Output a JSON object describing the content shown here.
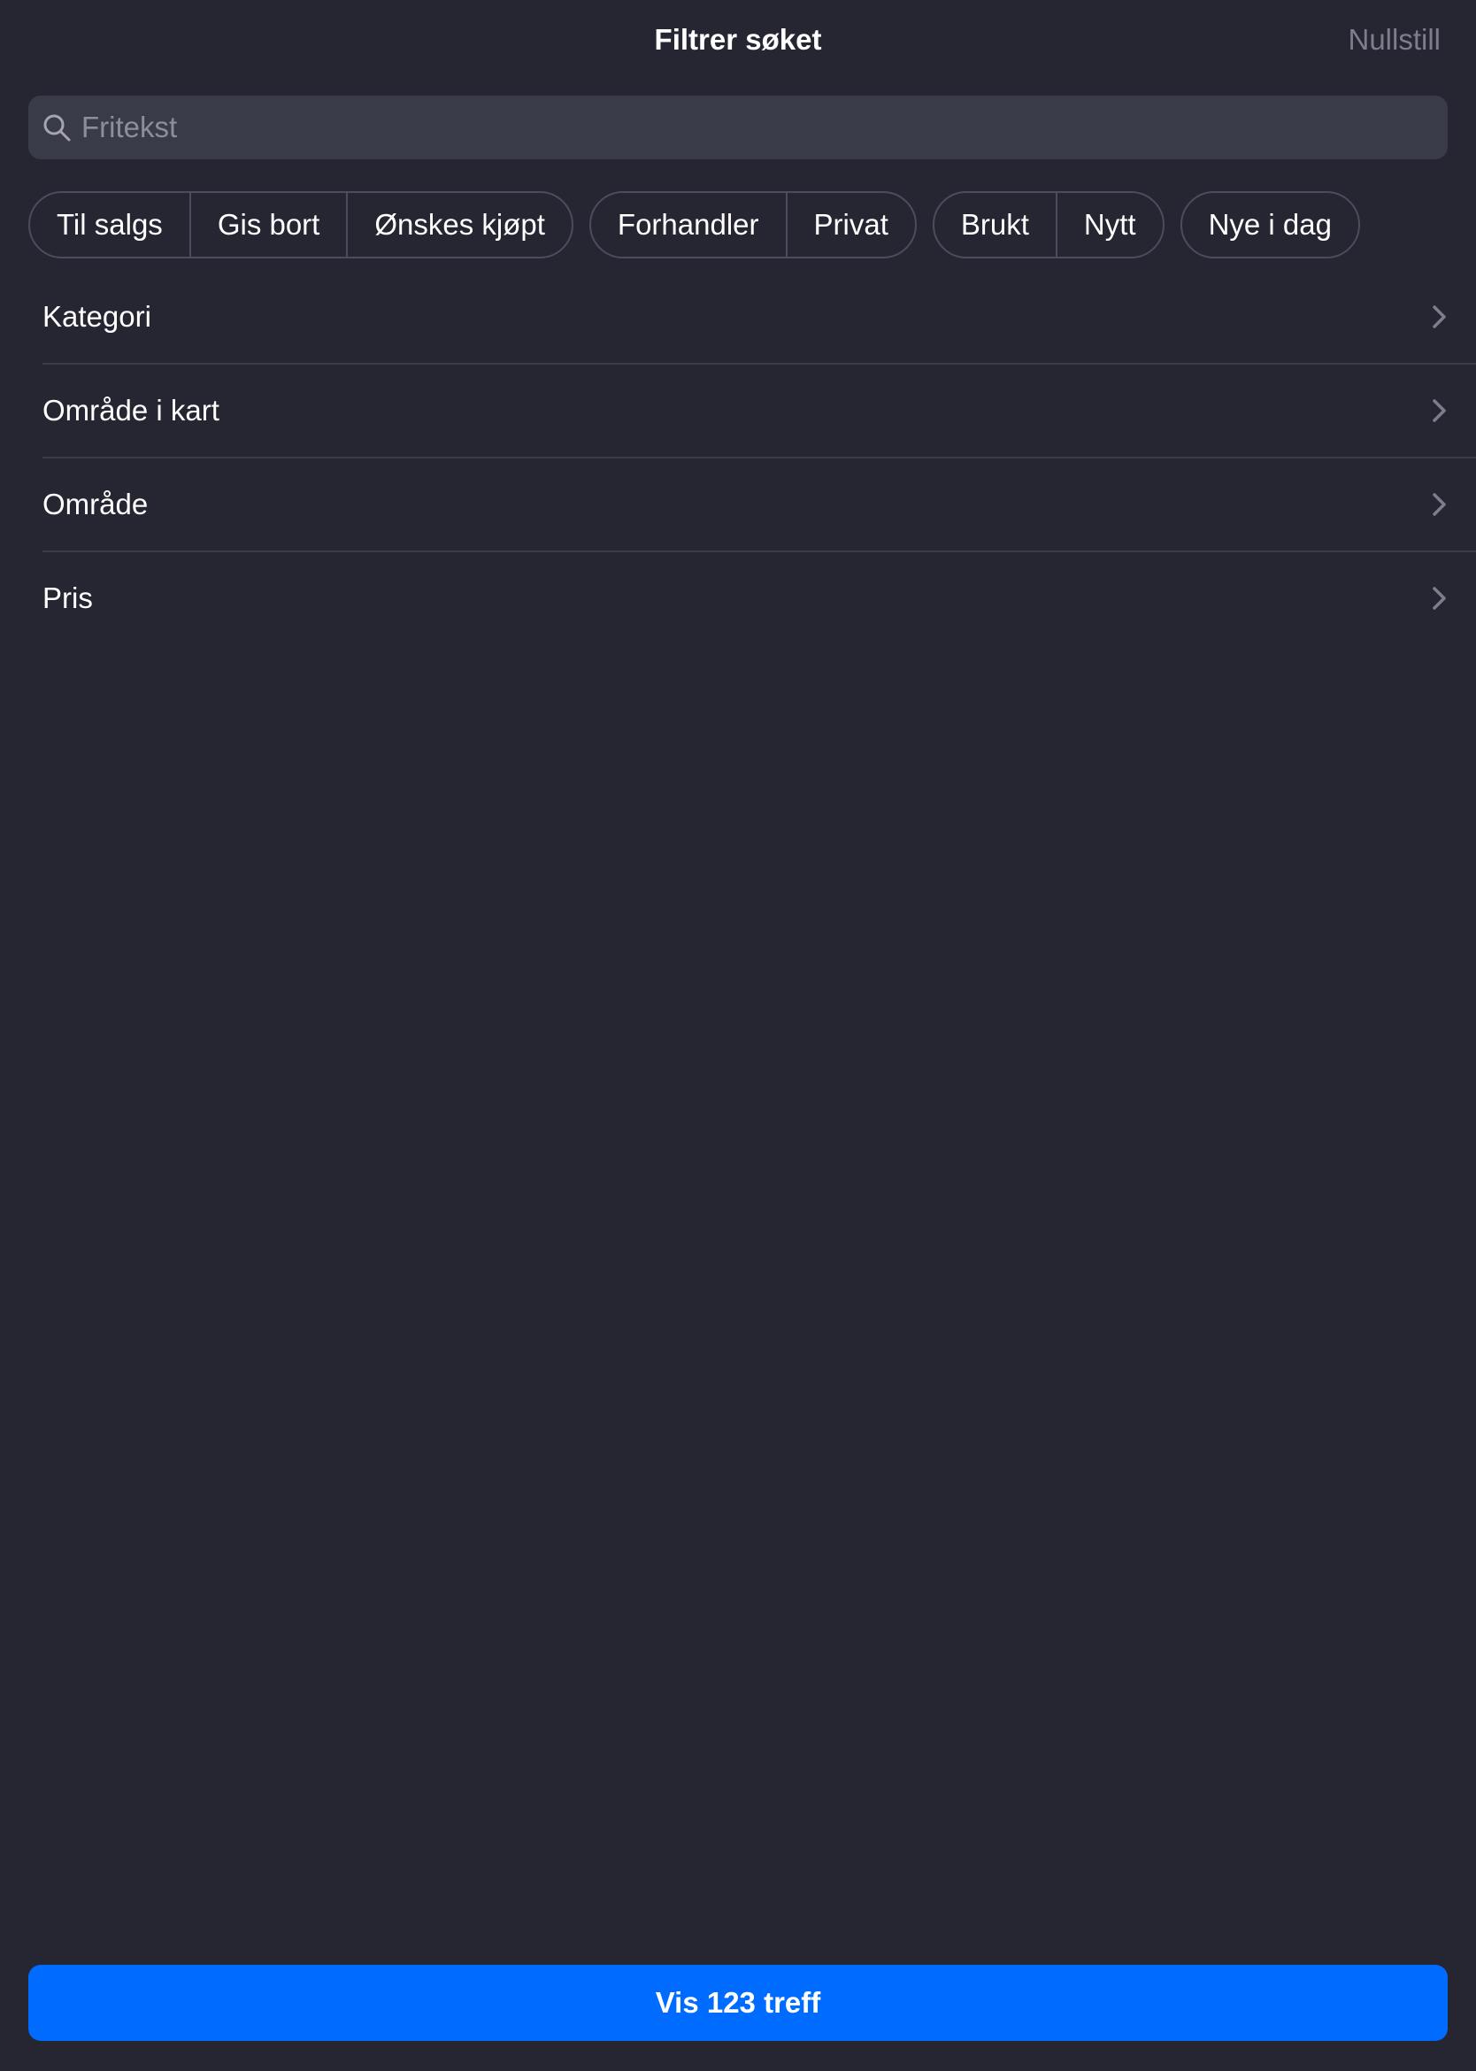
{
  "header": {
    "title": "Filtrer søket",
    "reset_label": "Nullstill"
  },
  "search": {
    "placeholder": "Fritekst",
    "value": ""
  },
  "chip_groups": [
    [
      "Til salgs",
      "Gis bort",
      "Ønskes kjøpt"
    ],
    [
      "Forhandler",
      "Privat"
    ],
    [
      "Brukt",
      "Nytt"
    ],
    [
      "Nye i dag"
    ]
  ],
  "filters": [
    {
      "label": "Kategori"
    },
    {
      "label": "Område i kart"
    },
    {
      "label": "Område"
    },
    {
      "label": "Pris"
    }
  ],
  "footer": {
    "show_results_label": "Vis 123 treff"
  },
  "colors": {
    "background": "#252632",
    "accent": "#006cff",
    "muted_text": "#7d7e8b"
  }
}
